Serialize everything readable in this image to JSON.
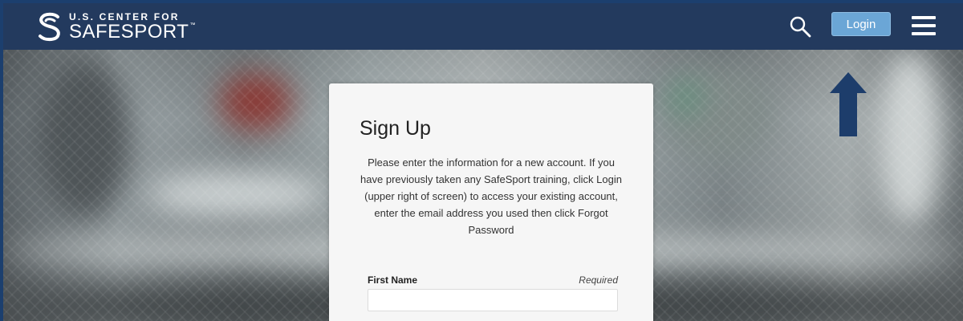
{
  "header": {
    "logo": {
      "line1": "U.S. CENTER FOR",
      "line2": "SAFESPORT",
      "tm": "™"
    },
    "search_icon": "search-icon",
    "login_label": "Login",
    "menu_icon": "hamburger-menu-icon"
  },
  "signup": {
    "title": "Sign Up",
    "description": "Please enter the information for a new account. If you have previously taken any SafeSport training, click Login (upper right of screen) to access your existing account, enter the email address you used then click Forgot Password",
    "fields": [
      {
        "label": "First Name",
        "required_label": "Required",
        "value": "",
        "placeholder": ""
      }
    ]
  },
  "annotation": {
    "arrow_icon": "up-arrow-icon"
  },
  "colors": {
    "frame_border": "#1c3f6e",
    "header_bg": "#233a5e",
    "login_button": "#6ba6d6",
    "arrow": "#1d3d6b",
    "card_bg": "#f6f6f6"
  }
}
